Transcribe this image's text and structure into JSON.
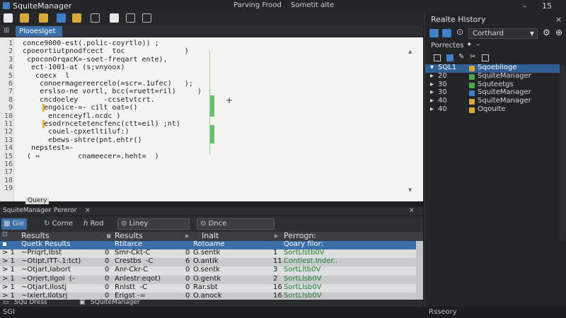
{
  "window": {
    "app_title": "SquiteManager",
    "doc_title": "Parving Frood",
    "doc_title_2": "Sometit alte",
    "controls": [
      "–",
      "15"
    ]
  },
  "editor": {
    "active_tab": "Plooeslget",
    "line_numbers": [
      "1",
      "2",
      "3",
      "4",
      "5",
      "6",
      "7",
      "8",
      "9",
      "10",
      "11",
      "12",
      "13",
      "14",
      "15",
      "16",
      "17",
      "18",
      "19"
    ],
    "lines": [
      "conce9000-est(.polic-coyrtlo)) ;",
      "cpoeortiutpnodfcect  toc              )",
      " cpoconOrqacK=-soet-freqart ente),",
      "  ect-1001-at (s;vnyoox)",
      "   coecx  l",
      "    conoermagereercelo(=scr=.1ufec)   );",
      "    erslso-ne vortl, bcc(=ruett=ril)     )",
      "    cncdoeley      -ccsetvtcrt.",
      "     engoice-=- cilt oat=()",
      "      encenceyfl.ncdc )",
      "     esodrncetetencfenc(ctt=eil) ;nt)",
      "      couel-cpxetltiluf:)",
      "      ebews-shtre(pnt.ehtr()",
      "  nepstest=-",
      " ( ⇔         cnameecer=.heht=  )",
      "",
      "",
      "",
      ""
    ],
    "gutter_marker": "+",
    "query_label": "Query"
  },
  "panel": {
    "name": "SquiteManager",
    "subtitle": "Pereror",
    "controls": [
      "–",
      "×"
    ]
  },
  "results_toolbar": {
    "tab_label": "Gie",
    "btn1": "Corne",
    "btn2": "Rod",
    "field1": "Liney",
    "field2": "Dnce"
  },
  "results": {
    "columns": [
      "Results",
      "Results",
      "Inalt",
      "Perrogn:"
    ],
    "header_row": [
      "Quetk Results",
      "Rtitarce",
      "Rotoame",
      "Qoary filor:"
    ],
    "rows": [
      {
        "mark": "> 1",
        "c1": "~Priqrt,Ibst",
        "n1": "0",
        "c2": "Smr-Ckt-C",
        "n2": "0",
        "c3": "G.sentk",
        "n3": "1",
        "c4": "SortLlstb0V"
      },
      {
        "mark": "> 1",
        "c1": "~Otipt,ITT-.1:tct)",
        "n1": "0",
        "c2": "Crestbs  -C",
        "n2": "6",
        "c3": "O.antik",
        "n3": "11",
        "c4": "Contlest.Inder.."
      },
      {
        "mark": "> 1",
        "c1": "~Otjart,Iabort",
        "n1": "0",
        "c2": "Anr-Ckr-C",
        "n2": "0",
        "c3": "O.sentk",
        "n3": "3",
        "c4": "SortLltb0V"
      },
      {
        "mark": "> 1",
        "c1": "~Orjert,Ilgol  (-",
        "n1": "0",
        "c2": "Anlestr:eqot)",
        "n2": "0",
        "c3": "O.gentk",
        "n3": "2",
        "c4": "SortLlsb0V"
      },
      {
        "mark": "> 1",
        "c1": "~Otjart,Ilostj",
        "n1": "0",
        "c2": "Rnlstt  -C",
        "n2": "0",
        "c3": "Rar.sbt",
        "n3": "16",
        "c4": "SortLlsb0V"
      },
      {
        "mark": "> 1",
        "c1": "~Ixiert,Ilotsrj",
        "n1": "0",
        "c2": "Erigst -=",
        "n2": "0",
        "c3": "O.anock",
        "n3": "16",
        "c4": "SortLlsb0V"
      }
    ]
  },
  "statusbar": {
    "left": "SQu Dress",
    "center": "SQuiteManager"
  },
  "bottombar": {
    "left": "SGI",
    "right": "Rsseory"
  },
  "right_panel": {
    "title": "Realte History",
    "close": "×",
    "select_value": "Corthard",
    "properties_label": "Porrectes",
    "tree": [
      {
        "n": "SQL1",
        "label": "Sqoeblioge",
        "color": "#d9a83a"
      },
      {
        "n": "20",
        "label": "SquiteManager",
        "color": "#4aa84a"
      },
      {
        "n": "30",
        "label": "Squteetgs",
        "color": "#4aa84a"
      },
      {
        "n": "30",
        "label": "SquiteManager",
        "color": "#3f7fc8"
      },
      {
        "n": "40",
        "label": "SquiteManager",
        "color": "#d9a83a"
      },
      {
        "n": "40",
        "label": "Oqoulte",
        "color": "#d9a83a"
      }
    ]
  }
}
